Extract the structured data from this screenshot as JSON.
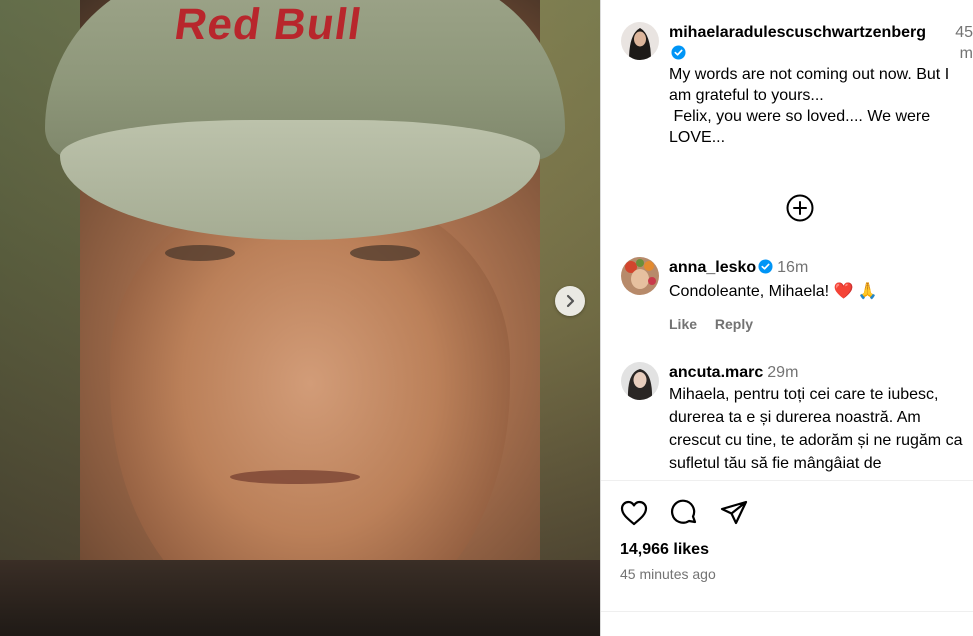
{
  "post": {
    "likes": "14,966 likes",
    "posted_ago": "45 minutes ago",
    "photo_logo": "Red Bull"
  },
  "comments": [
    {
      "username": "mihaelaradulescuschwartzenberg",
      "time": "45 m",
      "verified": true,
      "text": "My words are not coming out now. But I am grateful to yours...\n Felix, you were so loved.... We were LOVE..."
    },
    {
      "username": "anna_lesko",
      "time": "16m",
      "verified": true,
      "text": "Condoleante, Mihaela! ❤️ 🙏",
      "like_label": "Like",
      "reply_label": "Reply"
    },
    {
      "username": "ancuta.marc",
      "time": "29m",
      "verified": false,
      "text": "Mihaela, pentru toți cei care te iubesc, durerea ta e și durerea noastră. Am crescut cu tine, te adorăm și ne rugăm ca sufletul tău să fie mângâiat de"
    }
  ],
  "icons": {
    "next": "chevron-right-icon",
    "load_more": "plus-circle-icon",
    "like": "heart-icon",
    "comment": "comment-icon",
    "share": "send-icon",
    "verified": "verified-badge-icon"
  },
  "colors": {
    "verified_blue": "#0095f6",
    "muted_text": "#737373",
    "heart_red": "#ed4956"
  }
}
